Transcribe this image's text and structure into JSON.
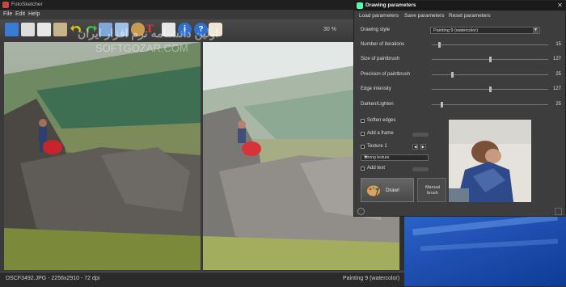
{
  "main": {
    "title": "FotoSketcher",
    "menu": [
      "File",
      "Edit",
      "Help"
    ],
    "zoom": "30 %",
    "watermark_fa": "اولین دانشنامه نرم افزار ایران",
    "watermark_en": "SOFTGOZAR.COM",
    "toolbar_icons": [
      "open-icon",
      "save-icon",
      "copy-icon",
      "paste-icon",
      "undo-icon",
      "redo-icon",
      "side-by-side-icon",
      "compare-icon",
      "palette-icon",
      "text-icon",
      "print-icon",
      "info-icon",
      "help-icon",
      "coffee-icon"
    ],
    "status_left": "DSCF3492.JPG - 2256x2910 - 72 dpi",
    "status_right": "Painting 9 (watercolor)"
  },
  "dialog": {
    "title": "Drawing parameters",
    "menu": [
      "Load parameters",
      "Save parameters",
      "Reset parameters"
    ],
    "drawing_style_label": "Drawing style",
    "drawing_style_value": "Painting 9 (watercolor)",
    "sliders": [
      {
        "label": "Number of iterations",
        "value": "15",
        "level": 0.06
      },
      {
        "label": "Size of paintbrush",
        "value": "127",
        "level": 0.5
      },
      {
        "label": "Precision of paintbrush",
        "value": "25",
        "level": 0.17
      },
      {
        "label": "Edge intensity",
        "value": "127",
        "level": 0.5
      },
      {
        "label": "Darken/Lighten",
        "value": "25",
        "level": 0.08
      }
    ],
    "soften_edges": "Soften edges",
    "add_frame": "Add a frame",
    "texture_label": "Texture 1",
    "texture_select": "Strong texture",
    "add_text": "Add text",
    "draw_button": "Draw!",
    "manual_button_1": "Manual",
    "manual_button_2": "brush"
  },
  "colors": {
    "dialog_bg": "#3d3d3d",
    "desktop": "#1e4fb0"
  }
}
